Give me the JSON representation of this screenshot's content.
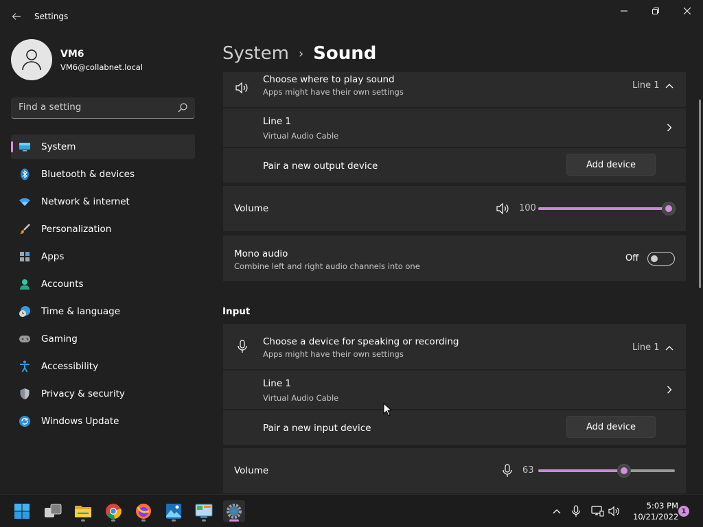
{
  "window": {
    "title": "Settings",
    "back_icon": "arrow-left-icon",
    "controls": [
      "minimize-icon",
      "maximize-icon",
      "close-icon"
    ]
  },
  "user": {
    "name": "VM6",
    "email": "VM6@collabnet.local",
    "avatar_icon": "person-icon"
  },
  "search": {
    "placeholder": "Find a setting",
    "icon": "search-icon"
  },
  "sidebar": {
    "accent": "#e08ce0",
    "items": [
      {
        "label": "System",
        "icon": "monitor-icon",
        "active": true
      },
      {
        "label": "Bluetooth & devices",
        "icon": "bluetooth-icon"
      },
      {
        "label": "Network & internet",
        "icon": "wifi-icon"
      },
      {
        "label": "Personalization",
        "icon": "brush-icon"
      },
      {
        "label": "Apps",
        "icon": "apps-icon"
      },
      {
        "label": "Accounts",
        "icon": "account-icon"
      },
      {
        "label": "Time & language",
        "icon": "clock-globe-icon"
      },
      {
        "label": "Gaming",
        "icon": "gamepad-icon"
      },
      {
        "label": "Accessibility",
        "icon": "accessibility-icon"
      },
      {
        "label": "Privacy & security",
        "icon": "shield-icon"
      },
      {
        "label": "Windows Update",
        "icon": "update-icon"
      }
    ]
  },
  "breadcrumb": {
    "parent": "System",
    "separator": "›",
    "current": "Sound"
  },
  "output": {
    "header_title": "Choose where to play sound",
    "header_sub": "Apps might have their own settings",
    "header_value": "Line 1",
    "device_name": "Line 1",
    "device_sub": "Virtual Audio Cable",
    "pair_label": "Pair a new output device",
    "add_button": "Add device",
    "volume_label": "Volume",
    "volume_value": "100",
    "volume_level": 1.0,
    "mono_title": "Mono audio",
    "mono_sub": "Combine left and right audio channels into one",
    "mono_state": "Off"
  },
  "input": {
    "section_title": "Input",
    "header_title": "Choose a device for speaking or recording",
    "header_sub": "Apps might have their own settings",
    "header_value": "Line 1",
    "device_name": "Line 1",
    "device_sub": "Virtual Audio Cable",
    "pair_label": "Pair a new input device",
    "add_button": "Add device",
    "volume_label": "Volume",
    "volume_value": "63",
    "volume_level": 0.63
  },
  "taskbar": {
    "apps": [
      "start-icon",
      "task-view-icon",
      "file-explorer-icon",
      "chrome-icon",
      "firefox-icon",
      "photos-icon",
      "control-panel-icon",
      "settings-icon"
    ],
    "time": "5:03 PM",
    "date": "10/21/2022",
    "notification_count": "1"
  }
}
